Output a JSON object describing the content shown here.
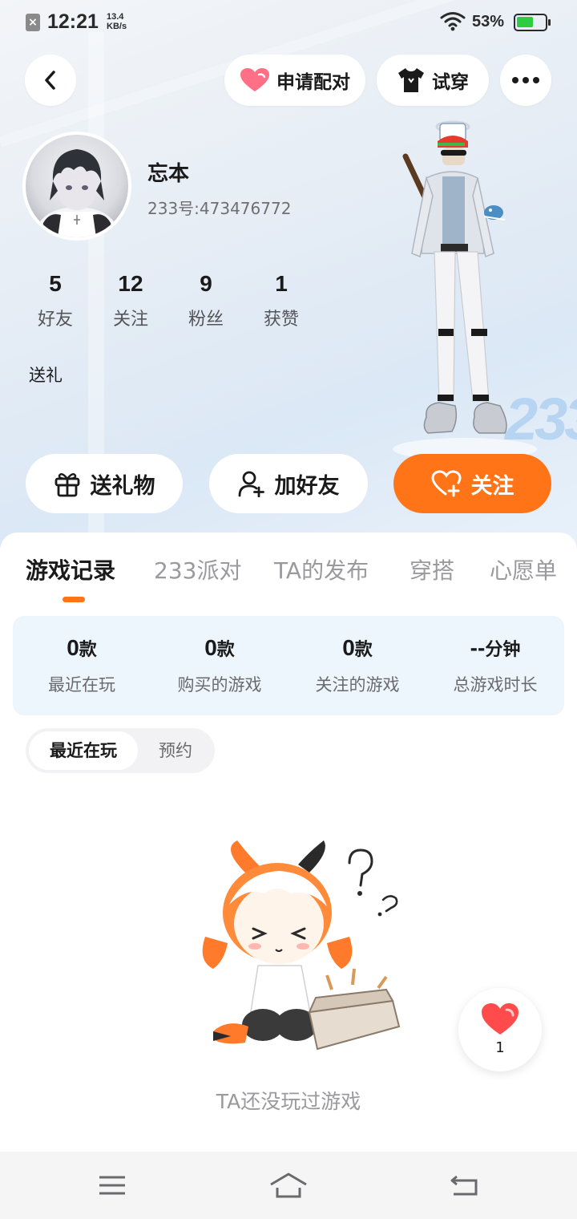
{
  "status_bar": {
    "time": "12:21",
    "speed_value": "13.4",
    "speed_unit": "KB/s",
    "battery": "53%",
    "battery_color": "#2ecc40"
  },
  "header": {
    "back_icon": "chevron-left-icon",
    "pair_label": "申请配对",
    "try_label": "试穿",
    "more_icon": "more-dots-icon"
  },
  "profile": {
    "name": "忘本",
    "id_text": "233号:473476772",
    "stats": [
      {
        "value": "5",
        "label": "好友"
      },
      {
        "value": "12",
        "label": "关注"
      },
      {
        "value": "9",
        "label": "粉丝"
      },
      {
        "value": "1",
        "label": "获赞"
      }
    ],
    "gift_text": "送礼",
    "deco": "233"
  },
  "actions": {
    "gift_label": "送礼物",
    "friend_label": "加好友",
    "follow_label": "关注",
    "accent": "#ff7417"
  },
  "tabs": [
    {
      "label": "游戏记录",
      "active": true
    },
    {
      "label": "233派对",
      "active": false
    },
    {
      "label": "TA的发布",
      "active": false
    },
    {
      "label": "穿搭",
      "active": false
    },
    {
      "label": "心愿单",
      "active": false
    }
  ],
  "game_stats": [
    {
      "value": "0",
      "unit": "款",
      "label": "最近在玩"
    },
    {
      "value": "0",
      "unit": "款",
      "label": "购买的游戏"
    },
    {
      "value": "0",
      "unit": "款",
      "label": "关注的游戏"
    },
    {
      "value": "--",
      "unit": "分钟",
      "label": "总游戏时长"
    }
  ],
  "segment": {
    "active": "最近在玩",
    "inactive": "预约"
  },
  "empty_state": {
    "text": "TA还没玩过游戏"
  },
  "like_fab": {
    "count": "1"
  },
  "navbar": {
    "menu_icon": "menu-icon",
    "home_icon": "home-icon",
    "back_icon": "back-arrow-icon"
  }
}
